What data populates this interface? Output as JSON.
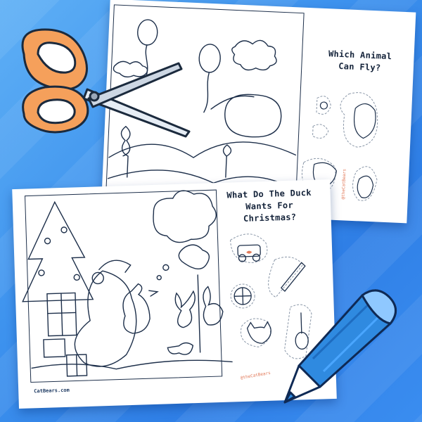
{
  "scene": {
    "background_color": "#3d92ee",
    "stripe_color": "#5fb0f5",
    "paper_color": "#ffffff",
    "line_color": "#1d2f4a",
    "accent_color": "#e27a5a"
  },
  "back_sheet": {
    "title_line1": "Which Animal",
    "title_line2": "Can Fly?",
    "credit": "@theCatBears",
    "stickers": [
      "flower-sticker",
      "cow-sticker",
      "bird-sticker",
      "goat-sticker",
      "deer-sticker"
    ]
  },
  "front_sheet": {
    "title_line1": "What Do The Duck",
    "title_line2": "Wants For Christmas?",
    "credit": "@theCatBears",
    "footer": "CatBears.com",
    "stickers": [
      "toy-car-sticker",
      "pencil-sticker",
      "basketball-sticker",
      "guitar-sticker",
      "cat-head-sticker"
    ]
  },
  "tools": {
    "scissors_handle_color": "#f5a05b",
    "pencil_color": "#2f8ae0"
  }
}
